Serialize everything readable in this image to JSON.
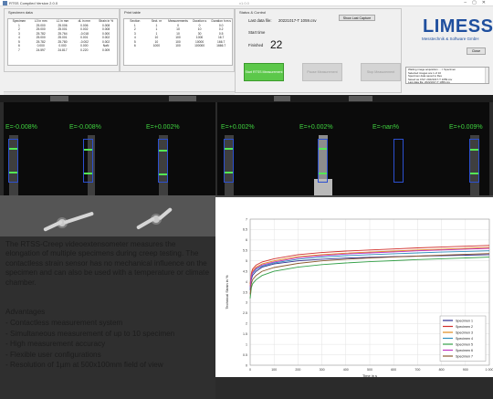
{
  "window": {
    "title": "RTSS Compiled Version 2.0.0",
    "center_text": "v1.0.0"
  },
  "specimen_panel": {
    "title": "Specimen data",
    "headers": [
      "Specimen",
      "L0 in mm",
      "L1 in mm",
      "dL in mm",
      "Strain in %"
    ],
    "rows": [
      [
        "1",
        "25.000",
        "25.006",
        "0.006",
        "0.008"
      ],
      [
        "2",
        "25.000",
        "25.001",
        "0.002",
        "0.008"
      ],
      [
        "3",
        "25.782",
        "25.764",
        "-0.018",
        "0.000"
      ],
      [
        "4",
        "25.000",
        "25.001",
        "0.001",
        "0.002"
      ],
      [
        "5",
        "25.782",
        "25.780",
        "-0.002",
        "0.002"
      ],
      [
        "6",
        "0.000",
        "0.000",
        "0.000",
        "NaN"
      ],
      [
        "7",
        "24.597",
        "24.817",
        "0.220",
        "0.009"
      ]
    ]
  },
  "print_panel": {
    "title": "Print table",
    "headers": [
      "Section",
      "Sect. nr",
      "Measurements",
      "Duration s",
      "Duration h:m:s"
    ],
    "rows": [
      [
        "1",
        "1",
        "0",
        "0",
        "0.0"
      ],
      [
        "2",
        "1",
        "10",
        "10",
        "0.2"
      ],
      [
        "3",
        "1",
        "10",
        "30",
        "0.5"
      ],
      [
        "4",
        "10",
        "100",
        "1000",
        "16.7"
      ],
      [
        "5",
        "10",
        "100",
        "10000",
        "166.7"
      ],
      [
        "6",
        "1000",
        "100",
        "100000",
        "1666.7"
      ]
    ]
  },
  "status": {
    "title": "Status & Control",
    "last_data_label": "Last data file:",
    "last_data_value": "20221017-T 1059.csv",
    "start_label": "Start time",
    "count_label": "Finished",
    "count_value": "22",
    "show_last_button": "Show Last Capture"
  },
  "buttons": {
    "start": "Start RTSS Measurement",
    "pause": "Pause Measurement",
    "stop": "Stop Measurement",
    "close": "Close"
  },
  "logo": {
    "title": "LIMESS",
    "subtitle": "Messtechnik & Software GmbH"
  },
  "log": {
    "lines": [
      "Waiting image acquisition ... = Specimen",
      "Selected images are 1 of 10",
      "Specimen data saved to files",
      "Saved as CSV: 20221017-T 1059.csv",
      "Last data file: 20221017-T 1059.csv"
    ]
  },
  "camera": {
    "labels": [
      "E=-0.008%",
      "E=-0.008%",
      "E=+0.002%",
      "E=+0.002%",
      "E=+0.002%",
      "E=-nan%",
      "E=+0.009%"
    ],
    "label_color": "#3fd23f",
    "box_color": "#2c50d0",
    "bar_color": "#54e754"
  },
  "description": {
    "text": "The RTSS-Creep videoextensometer measures the elongation of multiple specimens during creep testing. The contactless strain sensor has no mechanical influence on the specimen and can also be used with a temperature or climate chamber.",
    "advantages_title": "Advantages",
    "advantages": [
      "Contactless measurement system",
      "Simultaneous measurement of up to 10 specimen",
      "High measurement accuracy",
      "Flexible user configurations",
      "Resolution of 1µm at 500x100mm field of view"
    ]
  },
  "chart_data": {
    "type": "line",
    "title": "",
    "xlabel": "Time in s",
    "ylabel": "Technical Strain in %",
    "xlim": [
      0,
      1000
    ],
    "ylim": [
      0,
      7
    ],
    "x_ticks": [
      "0",
      "100",
      "200",
      "300",
      "400",
      "500",
      "600",
      "700",
      "800",
      "900",
      "1 000"
    ],
    "y_ticks": [
      "0",
      "0.5",
      "1",
      "1.5",
      "2",
      "2.5",
      "3",
      "3.5",
      "4",
      "4.5",
      "5",
      "5.5",
      "6",
      "6.5",
      "7"
    ],
    "grid": true,
    "legend_position": "bottom-right",
    "x": [
      0,
      5,
      10,
      25,
      50,
      100,
      200,
      300,
      400,
      500,
      600,
      700,
      800,
      900,
      1000
    ],
    "series": [
      {
        "name": "Specimen 1",
        "color": "#2f2f8f",
        "values": [
          3.6,
          4.1,
          4.3,
          4.5,
          4.7,
          4.85,
          5.0,
          5.08,
          5.13,
          5.17,
          5.2,
          5.23,
          5.25,
          5.27,
          5.3
        ]
      },
      {
        "name": "Specimen 2",
        "color": "#d1302b",
        "values": [
          3.9,
          4.4,
          4.6,
          4.8,
          4.95,
          5.1,
          5.3,
          5.4,
          5.47,
          5.52,
          5.57,
          5.62,
          5.66,
          5.7,
          5.74
        ]
      },
      {
        "name": "Specimen 3",
        "color": "#e08a1e",
        "values": [
          3.8,
          4.3,
          4.5,
          4.7,
          4.85,
          5.0,
          5.2,
          5.3,
          5.37,
          5.42,
          5.47,
          5.52,
          5.56,
          5.6,
          5.64
        ]
      },
      {
        "name": "Specimen 4",
        "color": "#2f8fbf",
        "values": [
          3.7,
          4.2,
          4.4,
          4.6,
          4.75,
          4.9,
          5.08,
          5.18,
          5.25,
          5.3,
          5.34,
          5.38,
          5.42,
          5.45,
          5.48
        ]
      },
      {
        "name": "Specimen 5",
        "color": "#34a048",
        "values": [
          3.2,
          3.7,
          3.9,
          4.1,
          4.3,
          4.5,
          4.7,
          4.82,
          4.9,
          4.96,
          5.01,
          5.06,
          5.1,
          5.14,
          5.18
        ]
      },
      {
        "name": "Specimen 6",
        "color": "#c034c0",
        "values": [
          3.75,
          4.25,
          4.45,
          4.65,
          4.8,
          4.95,
          5.15,
          5.25,
          5.33,
          5.38,
          5.43,
          5.48,
          5.52,
          5.56,
          5.6
        ]
      },
      {
        "name": "Specimen 7",
        "color": "#8a5a2e",
        "values": [
          3.4,
          3.9,
          4.1,
          4.3,
          4.5,
          4.68,
          4.88,
          5.0,
          5.08,
          5.14,
          5.19,
          5.23,
          5.27,
          5.31,
          5.35
        ]
      }
    ]
  }
}
